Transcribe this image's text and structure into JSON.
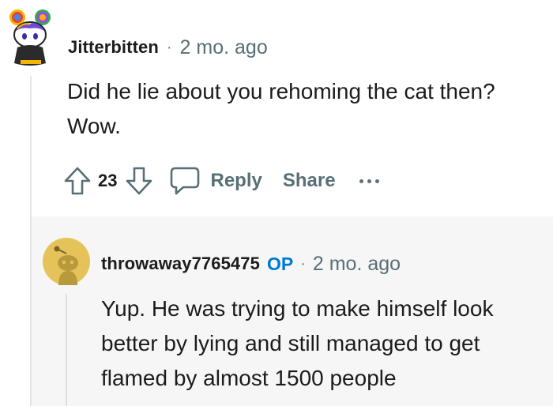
{
  "comment": {
    "username": "Jitterbitten",
    "separator": "·",
    "timestamp": "2 mo. ago",
    "body": "Did he lie about you rehoming the cat then? Wow.",
    "vote_count": "23",
    "actions": {
      "reply_label": "Reply",
      "share_label": "Share"
    }
  },
  "reply": {
    "username": "throwaway7765475",
    "badge": "OP",
    "separator": "·",
    "timestamp": "2 mo. ago",
    "body": "Yup. He was trying to make himself look better by lying and still managed to get flamed by almost 1500 people"
  },
  "colors": {
    "meta_gray": "#576f76",
    "op_blue": "#0079d3",
    "reply_background": "#f6f6f6",
    "avatar_yellow": "#e6c35a"
  },
  "icons": {
    "upvote": "upvote-arrow-icon",
    "downvote": "downvote-arrow-icon",
    "reply": "speech-bubble-icon",
    "more": "ellipsis-icon"
  }
}
